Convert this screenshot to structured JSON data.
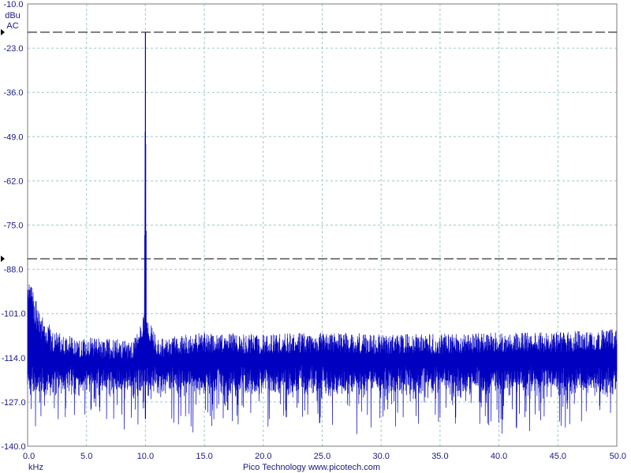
{
  "chart_data": {
    "type": "line",
    "xlabel": "kHz",
    "ylabel": "dBu",
    "coupling": "AC",
    "credit": "Pico Technology   www.picotech.com",
    "xlim": [
      0,
      50
    ],
    "ylim": [
      -140,
      -10
    ],
    "x_ticks": [
      "0.0",
      "5.0",
      "10.0",
      "15.0",
      "20.0",
      "25.0",
      "30.0",
      "35.0",
      "40.0",
      "45.0",
      "50.0"
    ],
    "y_ticks": [
      "-10.0",
      "-23.0",
      "-36.0",
      "-49.0",
      "-62.0",
      "-75.0",
      "-88.0",
      "-101.0",
      "-114.0",
      "-127.0",
      "-140.0"
    ],
    "grid": true,
    "markers": [
      -18.3,
      -84.9
    ],
    "series": [
      {
        "points": [
          [
            0.0,
            -88.5
          ],
          [
            0.5,
            -95
          ],
          [
            1.0,
            -100
          ],
          [
            2.0,
            -104
          ],
          [
            3.0,
            -105
          ],
          [
            4.0,
            -106
          ],
          [
            5.0,
            -106
          ],
          [
            7.0,
            -106.5
          ],
          [
            9.0,
            -106.5
          ],
          [
            9.9,
            -99
          ],
          [
            10.0,
            -18.3
          ],
          [
            10.1,
            -99
          ],
          [
            11.0,
            -106
          ],
          [
            15.0,
            -104.5
          ],
          [
            20.0,
            -105
          ],
          [
            25.0,
            -104.5
          ],
          [
            30.0,
            -105
          ],
          [
            35.0,
            -105
          ],
          [
            40.0,
            -104.5
          ],
          [
            45.0,
            -104.5
          ],
          [
            50.0,
            -103.5
          ]
        ],
        "noise_floor_low": -137,
        "color": "#0000c0"
      }
    ]
  }
}
